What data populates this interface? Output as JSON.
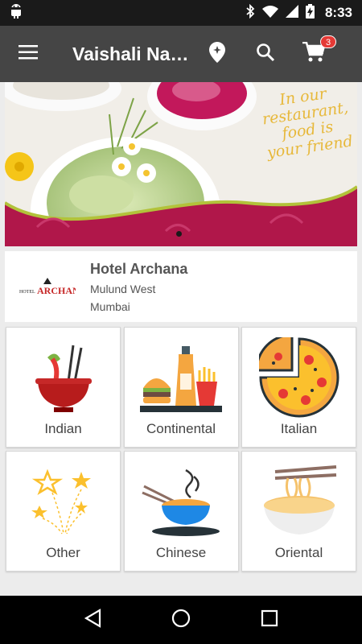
{
  "status_bar": {
    "time": "8:33",
    "icons": [
      "android-icon",
      "bluetooth-icon",
      "wifi-icon",
      "signal-icon",
      "battery-charging-icon"
    ]
  },
  "app_bar": {
    "title": "Vaishali Na…",
    "menu_icon": "hamburger-menu-icon",
    "location_icon": "location-pin-icon",
    "search_icon": "search-icon",
    "cart_icon": "cart-icon",
    "cart_count": "3"
  },
  "banner": {
    "slogan": "In our restaurant, food is your friend",
    "active_slide": 1
  },
  "restaurant": {
    "logo_small": "HOTEL",
    "logo_big": "ARCHANA",
    "name": "Hotel Archana",
    "area": "Mulund West",
    "city": "Mumbai"
  },
  "categories": [
    {
      "label": "Indian",
      "icon": "indian-bowl-icon"
    },
    {
      "label": "Continental",
      "icon": "burger-fries-icon"
    },
    {
      "label": "Italian",
      "icon": "pizza-icon"
    },
    {
      "label": "Other",
      "icon": "stars-icon"
    },
    {
      "label": "Chinese",
      "icon": "chopsticks-bowl-icon"
    },
    {
      "label": "Oriental",
      "icon": "noodles-icon"
    }
  ],
  "nav_bar": {
    "back_icon": "back-icon",
    "home_icon": "home-icon",
    "recents_icon": "recents-icon"
  },
  "colors": {
    "app_bar": "#454545",
    "banner_wave": "#b0174a",
    "badge": "#e53935"
  }
}
